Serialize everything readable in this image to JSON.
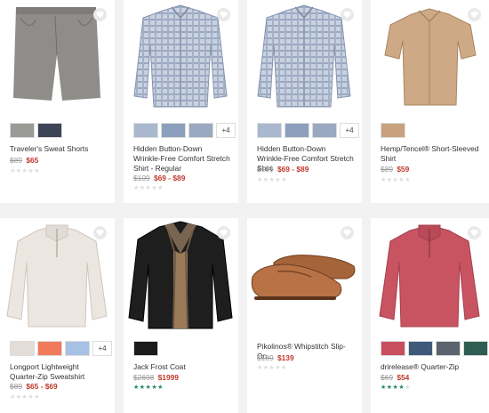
{
  "products": [
    {
      "name": "Traveler's Sweat Shorts",
      "was": "$89",
      "now": "$65",
      "rating": 0,
      "swatches": [
        "#9a9a96",
        "#3d4455"
      ],
      "more": ""
    },
    {
      "name": "Hidden Button-Down Wrinkle-Free Comfort Stretch Shirt - Regular",
      "was": "$109",
      "now": "$69 - $89",
      "rating": 0,
      "swatches": [
        "#a9b8cf",
        "#8ca0be",
        "#9aa8c0",
        "#5b7bd0"
      ],
      "more": "+4"
    },
    {
      "name": "Hidden Button-Down Wrinkle-Free Comfort Stretch Shirt",
      "was": "$109",
      "now": "$69 - $89",
      "rating": 0,
      "swatches": [
        "#a9b8cf",
        "#8ca0be",
        "#9aa8c0",
        "#5b7bd0"
      ],
      "more": "+4"
    },
    {
      "name": "Hemp/Tencel® Short-Sleeved Shirt",
      "was": "$89",
      "now": "$59",
      "rating": 0,
      "swatches": [
        "#c8a27c"
      ],
      "more": ""
    },
    {
      "name": "Longport Lightweight Quarter-Zip Sweatshirt",
      "was": "$89",
      "now": "$65 - $69",
      "rating": 0,
      "swatches": [
        "#e4dcd8",
        "#f07a5a",
        "#a7c1e4"
      ],
      "more": "+4"
    },
    {
      "name": "Jack Frost Coat",
      "was": "$2698",
      "now": "$1999",
      "rating": 5,
      "swatches": [
        "#1b1b1b"
      ],
      "more": ""
    },
    {
      "name": "Pikolinos® Whipstitch Slip-On",
      "was": "$189",
      "now": "$139",
      "rating": 0,
      "swatches": [],
      "more": ""
    },
    {
      "name": "drirelease® Quarter-Zip",
      "was": "$69",
      "now": "$54",
      "rating": 4,
      "swatches": [
        "#c8505e",
        "#3d5a7a",
        "#5b646e",
        "#2f5d52"
      ],
      "more": ""
    }
  ],
  "colors": {
    "sale": "#c0392b",
    "rating_star": "#1e8a6e",
    "empty_star": "#dddddd"
  }
}
